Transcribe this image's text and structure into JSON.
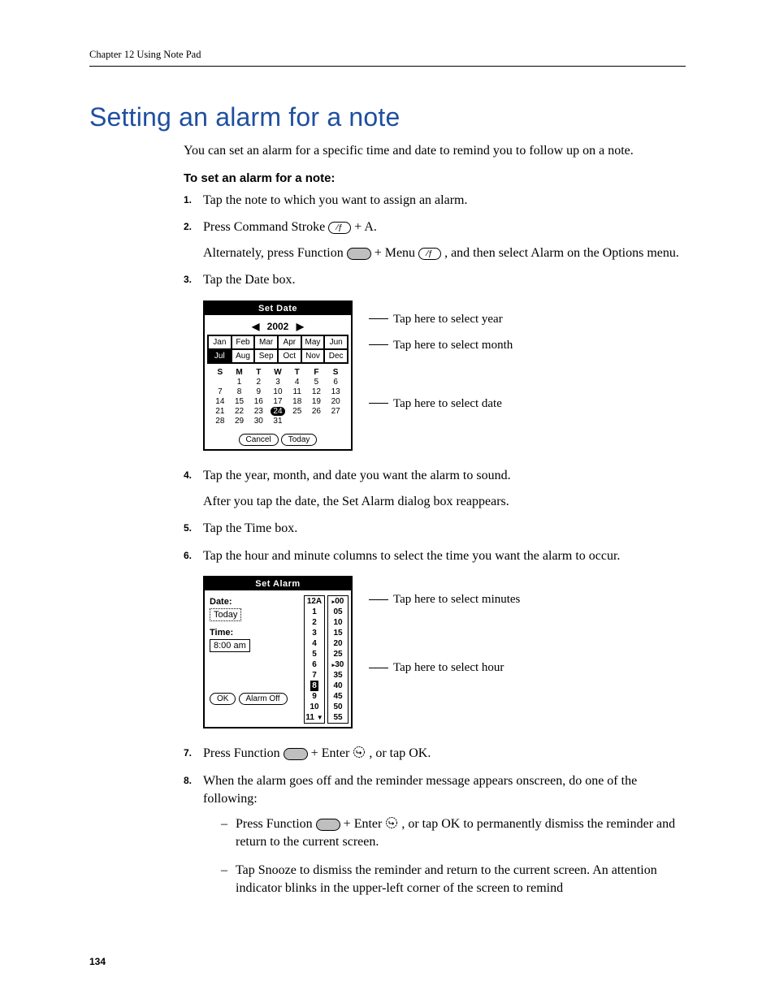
{
  "running_head": "Chapter 12   Using Note Pad",
  "title": "Setting an alarm for a note",
  "intro": "You can set an alarm for a specific time and date to remind you to follow up on a note.",
  "procedure_heading": "To set an alarm for a note:",
  "steps": {
    "s1": "Tap the note to which you want to assign an alarm.",
    "s2a": "Press Command Stroke ",
    "s2b": " + A.",
    "s2c_a": "Alternately, press Function ",
    "s2c_b": " + Menu ",
    "s2c_c": ", and then select Alarm on the Options menu.",
    "s3": "Tap the Date box.",
    "s4a": "Tap the year, month, and date you want the alarm to sound.",
    "s4b": "After you tap the date, the Set Alarm dialog box reappears.",
    "s5": "Tap the Time box.",
    "s6": "Tap the hour and minute columns to select the time you want the alarm to occur.",
    "s7a": "Press Function ",
    "s7b": " + Enter ",
    "s7c": ", or tap OK.",
    "s8": "When the alarm goes off and the reminder message appears onscreen, do one of the following:",
    "s8_sub1_a": "Press Function ",
    "s8_sub1_b": " + Enter ",
    "s8_sub1_c": ", or tap OK to permanently dismiss the reminder and return to the current screen.",
    "s8_sub2": "Tap Snooze to dismiss the reminder and return to the current screen. An attention indicator blinks in the upper-left corner of the screen to remind"
  },
  "set_date": {
    "title": "Set Date",
    "year": "2002",
    "months": [
      "Jan",
      "Feb",
      "Mar",
      "Apr",
      "May",
      "Jun",
      "Jul",
      "Aug",
      "Sep",
      "Oct",
      "Nov",
      "Dec"
    ],
    "selected_month_index": 6,
    "weekdays": [
      "S",
      "M",
      "T",
      "W",
      "T",
      "F",
      "S"
    ],
    "weeks": [
      [
        "",
        "1",
        "2",
        "3",
        "4",
        "5",
        "6"
      ],
      [
        "7",
        "8",
        "9",
        "10",
        "11",
        "12",
        "13"
      ],
      [
        "14",
        "15",
        "16",
        "17",
        "18",
        "19",
        "20"
      ],
      [
        "21",
        "22",
        "23",
        "24",
        "25",
        "26",
        "27"
      ],
      [
        "28",
        "29",
        "30",
        "31",
        "",
        "",
        ""
      ]
    ],
    "selected_day": "24",
    "cancel": "Cancel",
    "today": "Today"
  },
  "set_date_callouts": {
    "year": "Tap here to select year",
    "month": "Tap here to select month",
    "date": "Tap here to select date"
  },
  "set_alarm": {
    "title": "Set Alarm",
    "date_label": "Date:",
    "date_value": "Today",
    "time_label": "Time:",
    "time_value": "8:00 am",
    "ok": "OK",
    "alarm_off": "Alarm Off",
    "hours": [
      "12A",
      "1",
      "2",
      "3",
      "4",
      "5",
      "6",
      "7",
      "8",
      "9",
      "10",
      "11"
    ],
    "selected_hour": "8",
    "minutes": [
      "00",
      "05",
      "10",
      "15",
      "20",
      "25",
      "30",
      "35",
      "40",
      "45",
      "50",
      "55"
    ],
    "marked_minutes": [
      "00",
      "30"
    ]
  },
  "set_alarm_callouts": {
    "minutes": "Tap here to select minutes",
    "hour": "Tap here to select hour"
  },
  "page_number": "134"
}
